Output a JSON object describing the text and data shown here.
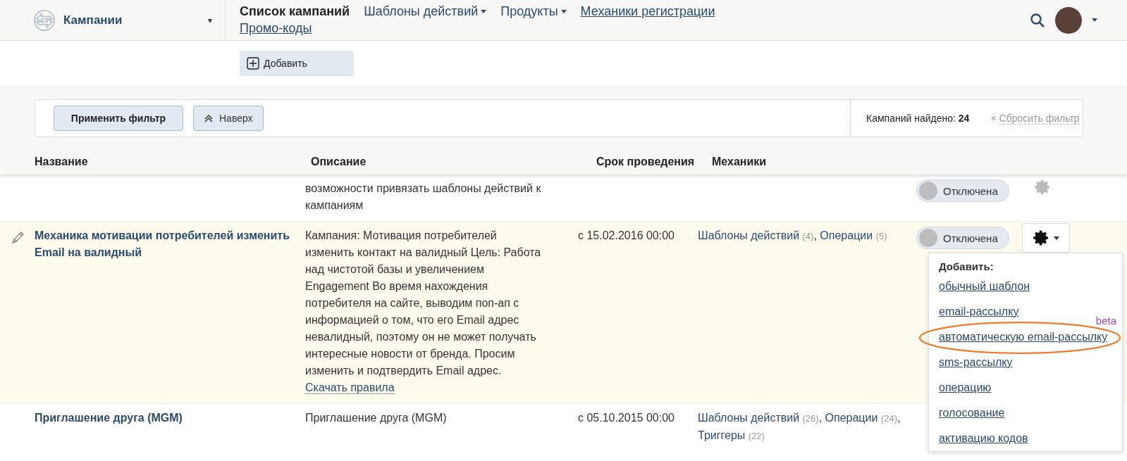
{
  "brand": {
    "title": "Кампании",
    "caret": "▾"
  },
  "nav": [
    {
      "label": "Список кампаний",
      "kind": "current"
    },
    {
      "label": "Шаблоны действий",
      "kind": "dropdown"
    },
    {
      "label": "Продукты",
      "kind": "dropdown"
    },
    {
      "label": "Механики регистрации",
      "kind": "link"
    },
    {
      "label": "Промо-коды",
      "kind": "link"
    }
  ],
  "toolbar": {
    "add_button": "Добавить"
  },
  "filter": {
    "apply_button": "Применить фильтр",
    "top_button": "Наверх",
    "found": "Кампаний найдено: **24**",
    "reset_mark": "×",
    "reset_link": "Сбросить фильтр"
  },
  "table": {
    "columns": [
      "Название",
      "Описание",
      "Срок проведения",
      "Механики"
    ],
    "rows": [
      {
        "highlighted": false,
        "description": "возможности привязать шаблоны действий к кампаниям",
        "toggle": {
          "label": "Отключена",
          "on": false
        }
      },
      {
        "highlighted": true,
        "editable": true,
        "name": "Механика мотивации потребителей изменить Email на валидный",
        "description": "Кампания: Мотивация потребителей изменить контакт на валидный Цель: Работа над чистотой базы и увеличением Engagement Во время нахождения потребителя на сайте, выводим поп-ап с информацией о том, что его Email адрес невалидный, поэтому он не может получать интересные новости от бренда. Просим изменить и подтвердить Email адрес.",
        "rules_link": "Скачать правила",
        "period": "с 15.02.2016 00:00",
        "mechanics": [
          {
            "name": "Шаблоны действий",
            "count": "(4)",
            "separator": ","
          },
          {
            "name": "Операции",
            "count": "(5)"
          }
        ],
        "toggle": {
          "label": "Отключена",
          "on": false
        },
        "menu": {
          "open": true,
          "title": "Добавить:",
          "items": [
            {
              "label": "обычный шаблон",
              "highlighted": false
            },
            {
              "label": "email-рассылку",
              "highlighted": false
            },
            {
              "label": "автоматическую email-рассылку",
              "badge": "beta",
              "highlighted": true
            },
            {
              "label": "sms-рассылку",
              "highlighted": false
            },
            {
              "label": "операцию",
              "highlighted": false
            },
            {
              "label": "голосование",
              "highlighted": false
            },
            {
              "label": "активацию кодов",
              "highlighted": false
            }
          ]
        }
      },
      {
        "highlighted": false,
        "editable": false,
        "name": "Приглашение друга (MGM)",
        "description": "Приглашение друга (MGM)",
        "period": "с 05.10.2015 00:00",
        "mechanics": [
          {
            "name": "Шаблоны действий",
            "count": "(26)",
            "separator": ","
          },
          {
            "name": "Операции",
            "count": "(24)",
            "separator": ","
          },
          {
            "name": "Триггеры",
            "count": "(22)"
          }
        ]
      }
    ]
  }
}
